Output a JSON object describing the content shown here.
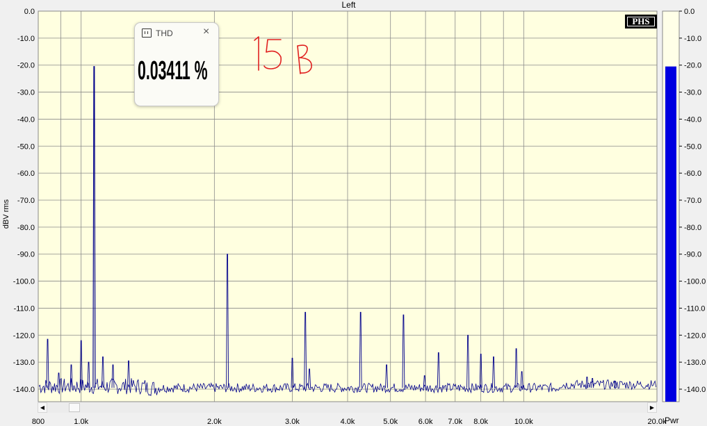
{
  "chart_data": {
    "type": "line",
    "title": "Left",
    "ylabel": "dBV rms",
    "xscale": "log",
    "xlim": [
      800,
      20000
    ],
    "ylim": [
      -145,
      0
    ],
    "grid": true,
    "yticks": [
      0,
      -10,
      -20,
      -30,
      -40,
      -50,
      -60,
      -70,
      -80,
      -90,
      -100,
      -110,
      -120,
      -130,
      -140
    ],
    "ytick_labels": [
      "0.0",
      "-10.0",
      "-20.0",
      "-30.0",
      "-40.0",
      "-50.0",
      "-60.0",
      "-70.0",
      "-80.0",
      "-90.0",
      "-100.0",
      "-110.0",
      "-120.0",
      "-130.0",
      "-140.0"
    ],
    "xticks": [
      800,
      1000,
      2000,
      3000,
      4000,
      5000,
      6000,
      7000,
      8000,
      10000,
      20000
    ],
    "xtick_labels": [
      "800",
      "1.0k",
      "2.0k",
      "3.0k",
      "4.0k",
      "5.0k",
      "6.0k",
      "7.0k",
      "8.0k",
      "10.0k",
      "20.0k"
    ],
    "noise_floor_db": -139.5,
    "series_color": "#00008b",
    "peaks": [
      {
        "x": 840,
        "y": -121.5
      },
      {
        "x": 890,
        "y": -134
      },
      {
        "x": 950,
        "y": -131
      },
      {
        "x": 1000,
        "y": -122
      },
      {
        "x": 1040,
        "y": -130
      },
      {
        "x": 1070,
        "y": -20.5
      },
      {
        "x": 1120,
        "y": -128
      },
      {
        "x": 1180,
        "y": -131
      },
      {
        "x": 1280,
        "y": -129.5
      },
      {
        "x": 2140,
        "y": -90
      },
      {
        "x": 3000,
        "y": -128.5
      },
      {
        "x": 3210,
        "y": -111.5
      },
      {
        "x": 3280,
        "y": -132.5
      },
      {
        "x": 4280,
        "y": -111.5
      },
      {
        "x": 4900,
        "y": -131
      },
      {
        "x": 5350,
        "y": -112.5
      },
      {
        "x": 5970,
        "y": -135
      },
      {
        "x": 6420,
        "y": -126.5
      },
      {
        "x": 7480,
        "y": -120
      },
      {
        "x": 8000,
        "y": -127
      },
      {
        "x": 8550,
        "y": -128
      },
      {
        "x": 9620,
        "y": -125
      },
      {
        "x": 9900,
        "y": -133.5
      },
      {
        "x": 13900,
        "y": -135.5
      },
      {
        "x": 14300,
        "y": -136
      },
      {
        "x": 16100,
        "y": -137
      }
    ]
  },
  "thd_popup": {
    "title": "THD",
    "close_glyph": "×",
    "value": "0.03411 %"
  },
  "annotation": {
    "handwriting": "15 B",
    "color": "#e02020"
  },
  "logo": {
    "text": "PHS"
  },
  "power_meter": {
    "label": "Pwr",
    "level_db": -20.5,
    "scale_labels": [
      "0.0",
      "-10.0",
      "-20.0",
      "-30.0",
      "-40.0",
      "-50.0",
      "-60.0",
      "-70.0",
      "-80.0",
      "-90.0",
      "-100.0",
      "-110.0",
      "-120.0",
      "-130.0",
      "-140.0"
    ],
    "fill_color": "#0000e0"
  },
  "scrollbar": {
    "left_arrow": "◀",
    "right_arrow": "▶"
  },
  "colors": {
    "plot_background": "#ffffe0",
    "grid": "#8a8a8a",
    "meter_background": "#ffffe8"
  }
}
